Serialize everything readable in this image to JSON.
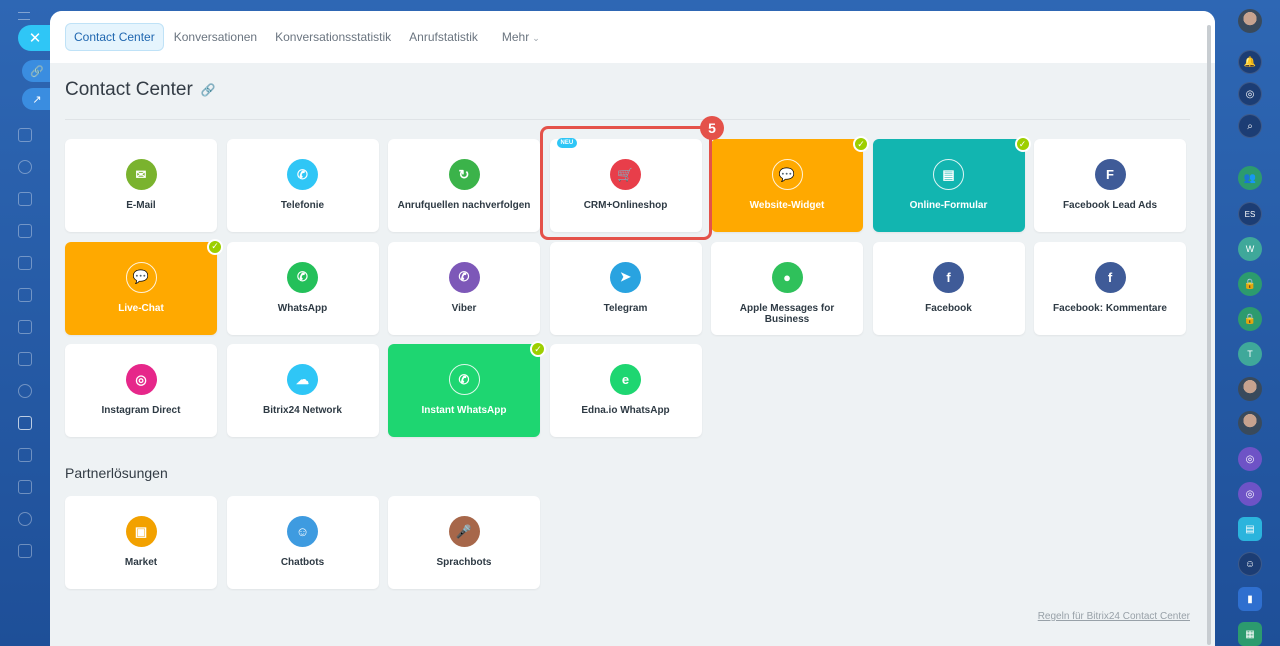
{
  "tabs": [
    {
      "label": "Contact Center",
      "active": true
    },
    {
      "label": "Konversationen",
      "active": false
    },
    {
      "label": "Konversationsstatistik",
      "active": false
    },
    {
      "label": "Anrufstatistik",
      "active": false
    },
    {
      "label": "Mehr",
      "active": false
    }
  ],
  "page_title": "Contact Center",
  "highlight_step": "5",
  "new_badge": "NEU",
  "tiles": [
    {
      "label": "E-Mail",
      "icon": "mail-icon",
      "color": "#7ab32e"
    },
    {
      "label": "Telefonie",
      "icon": "phone-icon",
      "color": "#2fc6f6"
    },
    {
      "label": "Anrufquellen nachverfolgen",
      "icon": "call-tracking-icon",
      "color": "#3bb34a"
    },
    {
      "label": "CRM+Onlineshop",
      "icon": "shop-cart-icon",
      "color": "#e83e4a"
    },
    {
      "label": "Website-Widget",
      "icon": "chat-widget-icon",
      "color": "#ffa900",
      "connected": true
    },
    {
      "label": "Online-Formular",
      "icon": "form-icon",
      "color": "#12b5b0",
      "connected": true
    },
    {
      "label": "Facebook Lead Ads",
      "icon": "lead-ads-icon",
      "color": "#3f5b98"
    },
    {
      "label": "Live-Chat",
      "icon": "live-chat-icon",
      "color": "#ffa900",
      "connected": true
    },
    {
      "label": "WhatsApp",
      "icon": "whatsapp-icon",
      "color": "#24c05a"
    },
    {
      "label": "Viber",
      "icon": "viber-icon",
      "color": "#7d58b8"
    },
    {
      "label": "Telegram",
      "icon": "telegram-icon",
      "color": "#29a3e0"
    },
    {
      "label": "Apple Messages for Business",
      "icon": "apple-messages-icon",
      "color": "#2fc15b"
    },
    {
      "label": "Facebook",
      "icon": "facebook-icon",
      "color": "#3f5b98"
    },
    {
      "label": "Facebook: Kommentare",
      "icon": "facebook-comments-icon",
      "color": "#3f5b98"
    },
    {
      "label": "Instagram Direct",
      "icon": "instagram-icon",
      "color": "#e6278a"
    },
    {
      "label": "Bitrix24 Network",
      "icon": "cloud-icon",
      "color": "#2fc6f6"
    },
    {
      "label": "Instant WhatsApp",
      "icon": "whatsapp-icon",
      "color": "#1ed671",
      "connected": true
    },
    {
      "label": "Edna.io WhatsApp",
      "icon": "edna-icon",
      "color": "#1ed671"
    }
  ],
  "partner_section_title": "Partnerlösungen",
  "partner_tiles": [
    {
      "label": "Market",
      "icon": "box-icon",
      "color": "#f2a100"
    },
    {
      "label": "Chatbots",
      "icon": "bot-icon",
      "color": "#3e9be0"
    },
    {
      "label": "Sprachbots",
      "icon": "microphone-icon",
      "color": "#a7674a"
    }
  ],
  "footer_link": "Regeln für Bitrix24 Contact Center"
}
